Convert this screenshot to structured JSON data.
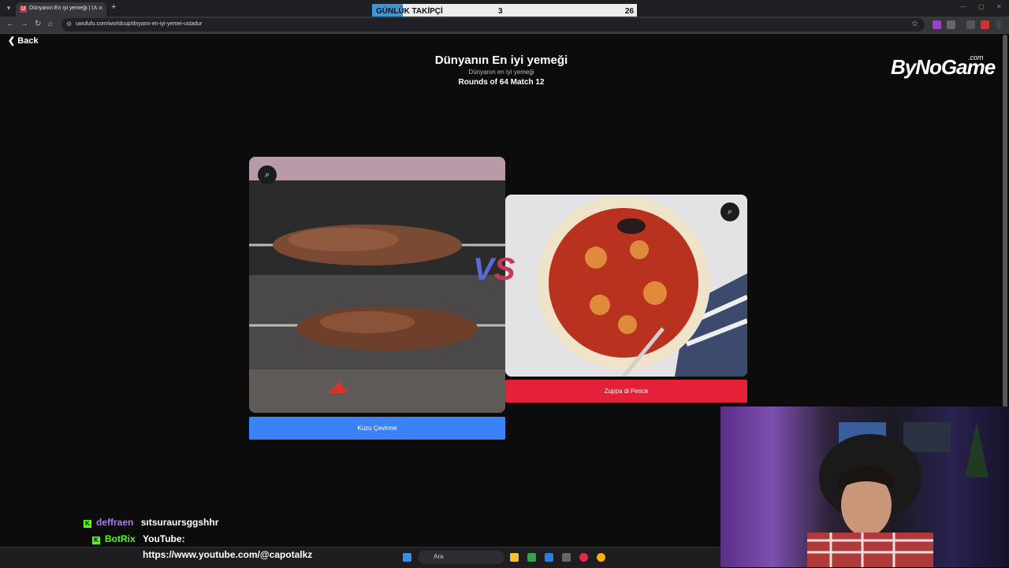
{
  "browser": {
    "tab_title": "Dünyanın En iyi yemeği | UwUf",
    "tab_favicon": "U",
    "url": "uwufufu.com/worldcup/dnyann-en-iyi-yemei-ustadur"
  },
  "follower_goal": {
    "label": "GÜNLÜK TAKİPÇİ",
    "current": "3",
    "goal": "26",
    "progress_fraction": 0.115
  },
  "page": {
    "back_label": "Back",
    "title": "Dünyanın En iyi yemeği",
    "subtitle": "Dünyanın en iyi yemeği",
    "round_info": "Rounds of 64 Match 12",
    "vs_v": "V",
    "vs_s": "S"
  },
  "logo": {
    "text": "ByNoGame",
    "suffix": ".com"
  },
  "choices": [
    {
      "label": "Kuzu Çevirme",
      "zoom_icon": "zoom-in-icon",
      "color": "#3b82f6"
    },
    {
      "label": "Zuppa di Pesce",
      "zoom_icon": "zoom-in-icon",
      "color": "#e5213a"
    }
  ],
  "chat": [
    {
      "user": "deffraen",
      "user_color": "#b374f5",
      "message": "sıtsuraursggshhr"
    },
    {
      "user": "BotRix",
      "user_color": "#53fc18",
      "message": "YouTube:"
    },
    {
      "user": "",
      "message": "https://www.youtube.com/@capotalkz"
    }
  ],
  "taskbar": {
    "search_placeholder": "Ara"
  }
}
